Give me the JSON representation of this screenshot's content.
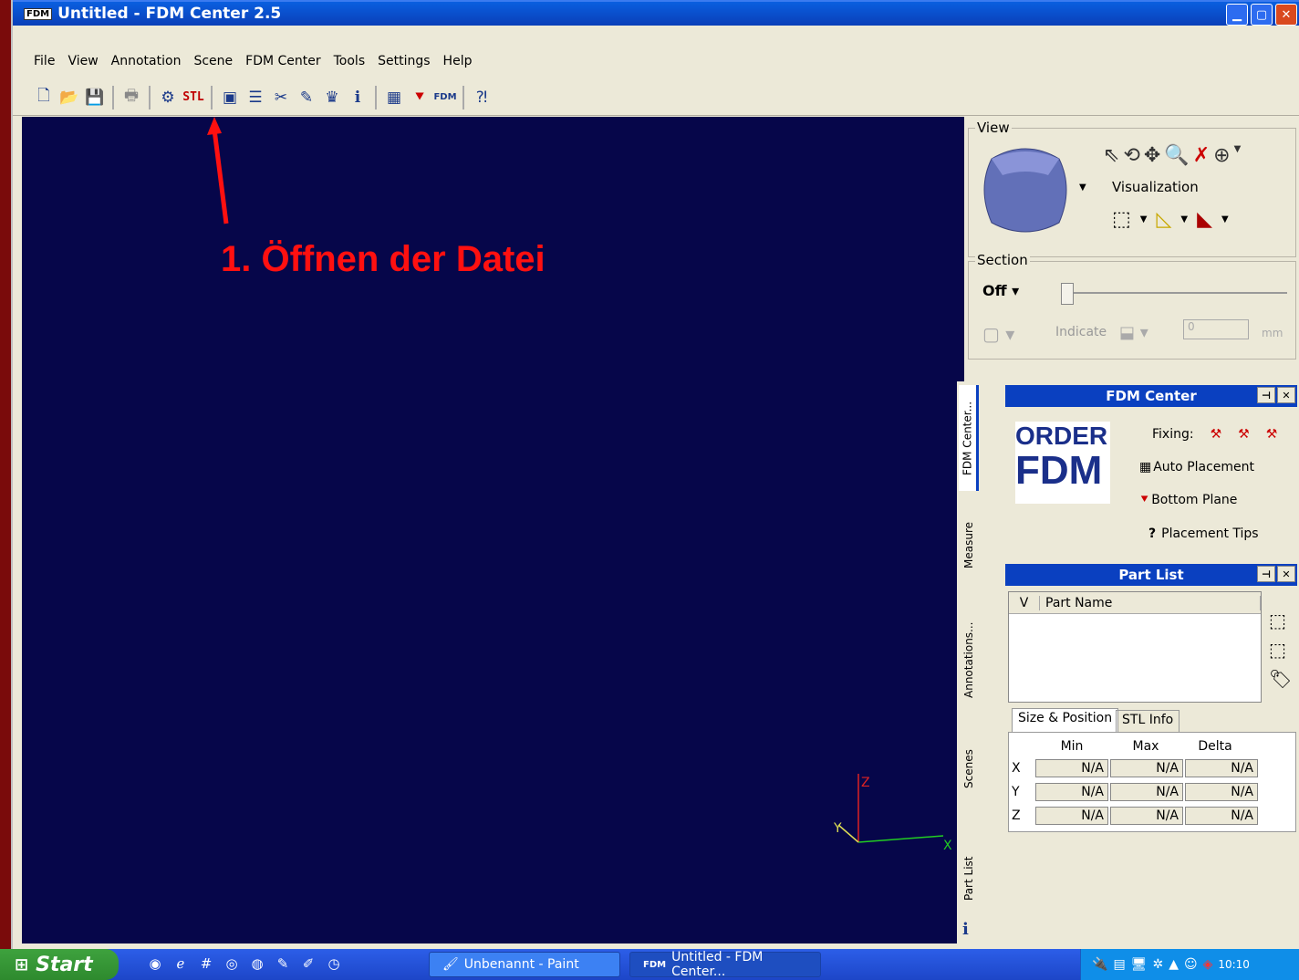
{
  "window": {
    "title": "Untitled - FDM Center 2.5",
    "app_icon": "FDM"
  },
  "menu": [
    "File",
    "View",
    "Annotation",
    "Scene",
    "FDM Center",
    "Tools",
    "Settings",
    "Help"
  ],
  "toolbar": {
    "stl_label": "STL",
    "info_label": "i"
  },
  "annotation": {
    "text": "1. Öffnen der Datei",
    "color": "#ff1010"
  },
  "axes": {
    "x": "X",
    "y": "Y",
    "z": "Z"
  },
  "view_panel": {
    "view_label": "View",
    "visualization_label": "Visualization",
    "section_label": "Section",
    "section_value": "Off",
    "indicate_label": "Indicate",
    "indicate_value": "0",
    "unit": "mm"
  },
  "fdm_panel": {
    "title": "FDM Center",
    "logo_line1": "ORDER",
    "logo_line2": "FDM",
    "fixing_label": "Fixing:",
    "auto_placement": "Auto Placement",
    "bottom_plane": "Bottom Plane",
    "placement_tips_q": "?",
    "placement_tips": "Placement Tips"
  },
  "part_list": {
    "title": "Part List",
    "col_v": "V",
    "col_name": "Part Name"
  },
  "tabs": {
    "size_position": "Size & Position",
    "stl_info": "STL Info"
  },
  "size_table": {
    "headers": [
      "Min",
      "Max",
      "Delta"
    ],
    "rows": [
      {
        "axis": "X",
        "values": [
          "N/A",
          "N/A",
          "N/A"
        ]
      },
      {
        "axis": "Y",
        "values": [
          "N/A",
          "N/A",
          "N/A"
        ]
      },
      {
        "axis": "Z",
        "values": [
          "N/A",
          "N/A",
          "N/A"
        ]
      }
    ]
  },
  "side_tabs": [
    "FDM Center...",
    "Measure",
    "Annotations...",
    "Scenes",
    "Part List"
  ],
  "side_tab_info": "i",
  "taskbar": {
    "start": "Start",
    "tasks": [
      {
        "label": "Unbenannt - Paint"
      },
      {
        "label": "Untitled - FDM Center..."
      }
    ],
    "task_icon": "FDM",
    "clock": "10:10"
  }
}
